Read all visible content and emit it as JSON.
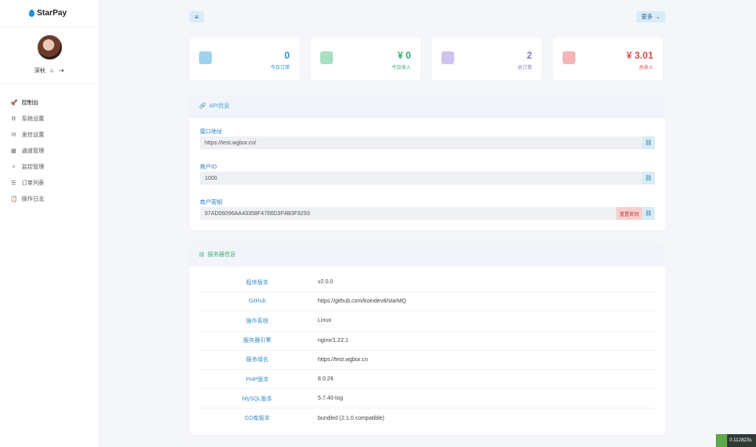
{
  "app": {
    "brand": "StarPay"
  },
  "user": {
    "name": "深秋"
  },
  "nav": [
    {
      "label": "控制台",
      "icon": "rocket-icon",
      "glyph": "🚀",
      "active": true
    },
    {
      "label": "系统设置",
      "icon": "gear-icon",
      "glyph": "⚙"
    },
    {
      "label": "发信设置",
      "icon": "mail-icon",
      "glyph": "✉"
    },
    {
      "label": "通道管理",
      "icon": "grid-icon",
      "glyph": "▦"
    },
    {
      "label": "监控管理",
      "icon": "bolt-icon",
      "glyph": "⚡"
    },
    {
      "label": "订单列表",
      "icon": "list-icon",
      "glyph": "☰"
    },
    {
      "label": "操作日志",
      "icon": "clipboard-icon",
      "glyph": "📋"
    }
  ],
  "header": {
    "menu_glyph": "≡",
    "more_label": "更多",
    "more_caret": "⌄"
  },
  "stats": [
    {
      "value": "0",
      "label": "今日订单",
      "color": "#2a8fd0",
      "icon": "briefcase-icon",
      "icon_color": "#9fd2ee"
    },
    {
      "value": "¥ 0",
      "label": "今日收入",
      "color": "#2fae6a",
      "icon": "wallet-icon",
      "icon_color": "#a6e2bf"
    },
    {
      "value": "2",
      "label": "总订单",
      "color": "#8a6fd6",
      "icon": "chart-icon",
      "icon_color": "#cfc3f0"
    },
    {
      "value": "¥ 3.01",
      "label": "总收入",
      "color": "#d94c4c",
      "icon": "yen-icon",
      "icon_color": "#f3b6b6"
    }
  ],
  "api": {
    "title": "API信息",
    "fields": [
      {
        "label": "接口地址",
        "value": "https://test.wgbor.cn/"
      },
      {
        "label": "商户ID",
        "value": "1000"
      },
      {
        "label": "商户密钥",
        "value": "97AD06096AA43358F4766D3F4B3F9293",
        "reset_label": "重置密钥"
      }
    ],
    "copy_glyph": "⛓"
  },
  "server": {
    "title": "服务器信息",
    "rows": [
      {
        "key": "程序版本",
        "value": "v2.0.0"
      },
      {
        "key": "GitHub",
        "value": "https://github.com/koindev8/starMQ"
      },
      {
        "key": "操作系统",
        "value": "Linux"
      },
      {
        "key": "服务器引擎",
        "value": "nginx/1.22.1"
      },
      {
        "key": "服务域名",
        "value": "https://test.wgbor.cn"
      },
      {
        "key": "PHP版本",
        "value": "8.0.26"
      },
      {
        "key": "MySQL版本",
        "value": "5.7.40-log"
      },
      {
        "key": "GD库版本",
        "value": "bundled (2.1.0 compatible)"
      }
    ]
  },
  "badge": {
    "text": "0.112823s"
  }
}
